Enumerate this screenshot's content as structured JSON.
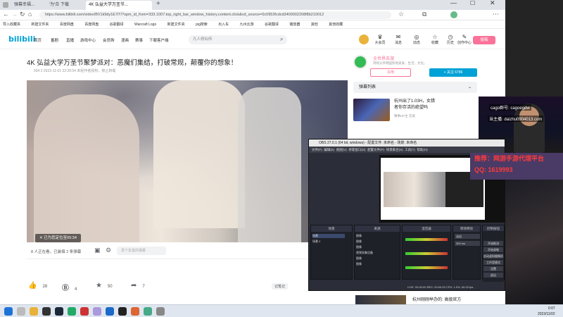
{
  "browser": {
    "tabs": [
      "弹幕幸福...",
      "'为'合 下载",
      "4K 弘益大学万圣节..."
    ],
    "url": "https://www.bilibili.com/video/BV1k9dy1E7iT/?spm_id_from=333.1007.top_right_bar_window_history.content.click&vd_source=0c0953fcdcd3400002208f8b210012",
    "bookmarks": [
      "导入收藏夹",
      "新建文件夹",
      "百度网盘",
      "百度网盘",
      "谷歌翻译",
      "Warcraft Logo",
      "新建文件夹",
      "pig搜索",
      "出入车",
      "九州云游",
      "谷歌翻译",
      "播放器",
      "其他",
      "其他收藏"
    ]
  },
  "bili": {
    "logo": "bilibili",
    "nav": [
      "首页",
      "番剧",
      "直播",
      "游戏中心",
      "会员购",
      "漫画",
      "赛事",
      "下载客户端"
    ],
    "search_placeholder": "凡人修仙传",
    "user_icons": [
      "大会员",
      "消息",
      "动态",
      "收藏",
      "历史",
      "创作中心"
    ],
    "upload": "投稿"
  },
  "video": {
    "title": "4K 弘益大学万圣节聚梦派对：恶魔们集结，打破常规，颠覆你的想象！",
    "meta": "594   2   2023-11-01 22:20:54   未经作者授权，禁止转载",
    "position_tip": "已为您定位至05:34",
    "watching": "8 人正在看，已装填 2 条弹幕",
    "danmu_placeholder": "发个友善的弹幕",
    "likes": "28",
    "coins": "4",
    "favs": "50",
    "shares": "7",
    "note_btn": "记笔记"
  },
  "uploader": {
    "name": "全世界去溜",
    "desc": "持续分享韩国各地美食，生活，文化。",
    "charge": "充电",
    "follow": "+ 关注 6786"
  },
  "sidebar": {
    "danmu_list": "弹幕列表",
    "rec_title": "杭州出了1.03H，女猎者你存活的绝望吗",
    "rec_up": "赛事UP主 恋爱"
  },
  "obs": {
    "title": "OBS 27.0.1 (64 bit, windows) - 配置文件: 未命名 - 场景: 未命名",
    "menu": [
      "文件(F)",
      "编辑(E)",
      "视图(V)",
      "停靠窗口(D)",
      "配置文件(P)",
      "场景集合(S)",
      "工具(T)",
      "帮助(H)"
    ],
    "docks": [
      "场景",
      "来源",
      "混音器",
      "转场特效",
      "控制按钮"
    ],
    "sources": [
      "图像",
      "图像",
      "图像",
      "视频采集设备",
      "图像",
      "图像"
    ],
    "scene": "场景",
    "scene2": "场景 2",
    "transition": "淡出",
    "duration": "300 ms",
    "controls": [
      "开始推流",
      "开始录制",
      "启动虚拟摄像机",
      "工作室模式",
      "设置",
      "退出"
    ],
    "status": "LIVE: 00:00:00  REC: 00:00:00  CPU: 1.9%, 60.00 fps"
  },
  "cam": {
    "group": "cago群号: cagoegdw",
    "id": "当主播: daizhu0904013.com"
  },
  "promo": {
    "line1": "推荐：网游手游代理平台",
    "line2": "QQ: 1619993"
  },
  "bottom": {
    "title": "杭州刚刚举办的: 高级官方"
  },
  "taskbar": {
    "time": "0:07",
    "date": "2023/11/02"
  }
}
